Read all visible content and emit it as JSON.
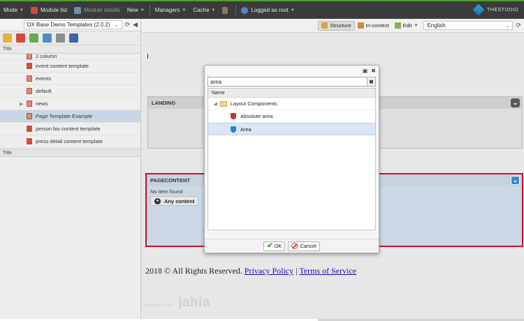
{
  "topbar": {
    "mode": "Mode",
    "module_list": "Module list",
    "module_details": "Module details",
    "new": "New",
    "managers": "Managers",
    "cache": "Cache",
    "logged_as": "Logged as root",
    "logo_text": "THESTUDIO"
  },
  "left_panel": {
    "selector": "DX Base Demo Templates (2.0.2)",
    "column_title": "Title",
    "items": [
      {
        "label": "2 column"
      },
      {
        "label": "event content template"
      },
      {
        "label": "events"
      },
      {
        "label": "default"
      },
      {
        "label": "news"
      },
      {
        "label": "Page Template Example"
      },
      {
        "label": "person bio content template"
      },
      {
        "label": "press detail content template"
      }
    ],
    "column_title_bottom": "Title"
  },
  "right_toolbar": {
    "structure": "Structure",
    "in_context": "In-context",
    "edit": "Edit",
    "language": "English"
  },
  "page": {
    "landing_title": "LANDING",
    "pagecontent_title": "PAGECONTENT",
    "no_item": "No item found",
    "any_content": "Any content",
    "footer_text": "2018 © All Rights Reserved.",
    "privacy_link": "Privacy Policy",
    "footer_sep": "|",
    "terms_link": "Terms of Service",
    "powered": "powered by",
    "brand": "jahia"
  },
  "dialog": {
    "search_value": "area",
    "column_name": "Name",
    "group": "Layout Components",
    "rows": [
      {
        "label": "Absolute area"
      },
      {
        "label": "Area"
      }
    ],
    "ok": "OK",
    "cancel": "Cancel"
  }
}
